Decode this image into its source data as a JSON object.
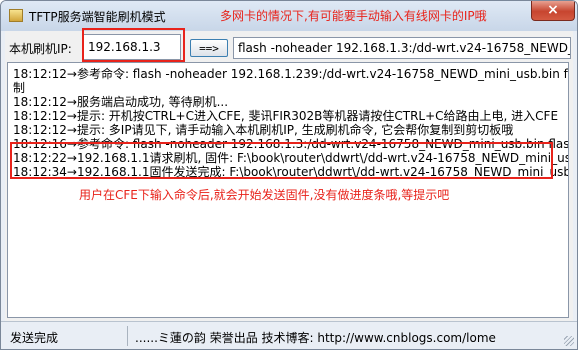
{
  "window": {
    "title": "TFTP服务端智能刷机模式",
    "title_annotation": "多网卡的情况下,有可能要手动输入有线网卡的IP哦",
    "close_label": "×"
  },
  "toolbar": {
    "ip_label": "本机刷机IP:",
    "ip_value": "192.168.1.3",
    "go_label": "==>",
    "command": "flash -noheader 192.168.1.3:/dd-wrt.v24-16758_NEWD_mini_usb.bin flash1.trx"
  },
  "log": {
    "lines": [
      "18:12:12→参考命令: flash -noheader 192.168.1.239:/dd-wrt.v24-16758_NEWD_mini_usb.bin flash1.trx, 已复",
      "制",
      "18:12:12→服务端启动成功, 等待刷机...",
      "18:12:12→提示: 开机按CTRL+C进入CFE, 斐讯FIR302B等机器请按住CTRL+C给路由上电, 进入CFE",
      "18:12:12→提示: 多IP请见下, 请手动输入本机刷机IP, 生成刷机命令, 它会帮你复制到剪切板哦",
      "18:12:16→参考命令: flash -noheader 192.168.1.3:/dd-wrt.v24-16758_NEWD_mini_usb.bin flash1.trx, 已复制",
      "18:12:22→192.168.1.1请求刷机, 固件: F:\\book\\router\\ddwrt\\/dd-wrt.v24-16758_NEWD_mini_usb.bin",
      "18:12:34→192.168.1.1固件发送完成: F:\\book\\router\\ddwrt\\/dd-wrt.v24-16758_NEWD_mini_usb.bin"
    ],
    "annotation": "用户在CFE下输入命令后,就会开始发送固件,没有做进度条哦,等提示吧"
  },
  "status": {
    "left": "发送完成",
    "right": "......ミ蓮の韵 荣誉出品  技术博客: http://www.cnblogs.com/lome"
  },
  "colors": {
    "annotation": "#e8231b",
    "close_button": "#c7452f"
  },
  "icons": [
    "app-icon",
    "close-icon",
    "resize-grip-icon"
  ]
}
